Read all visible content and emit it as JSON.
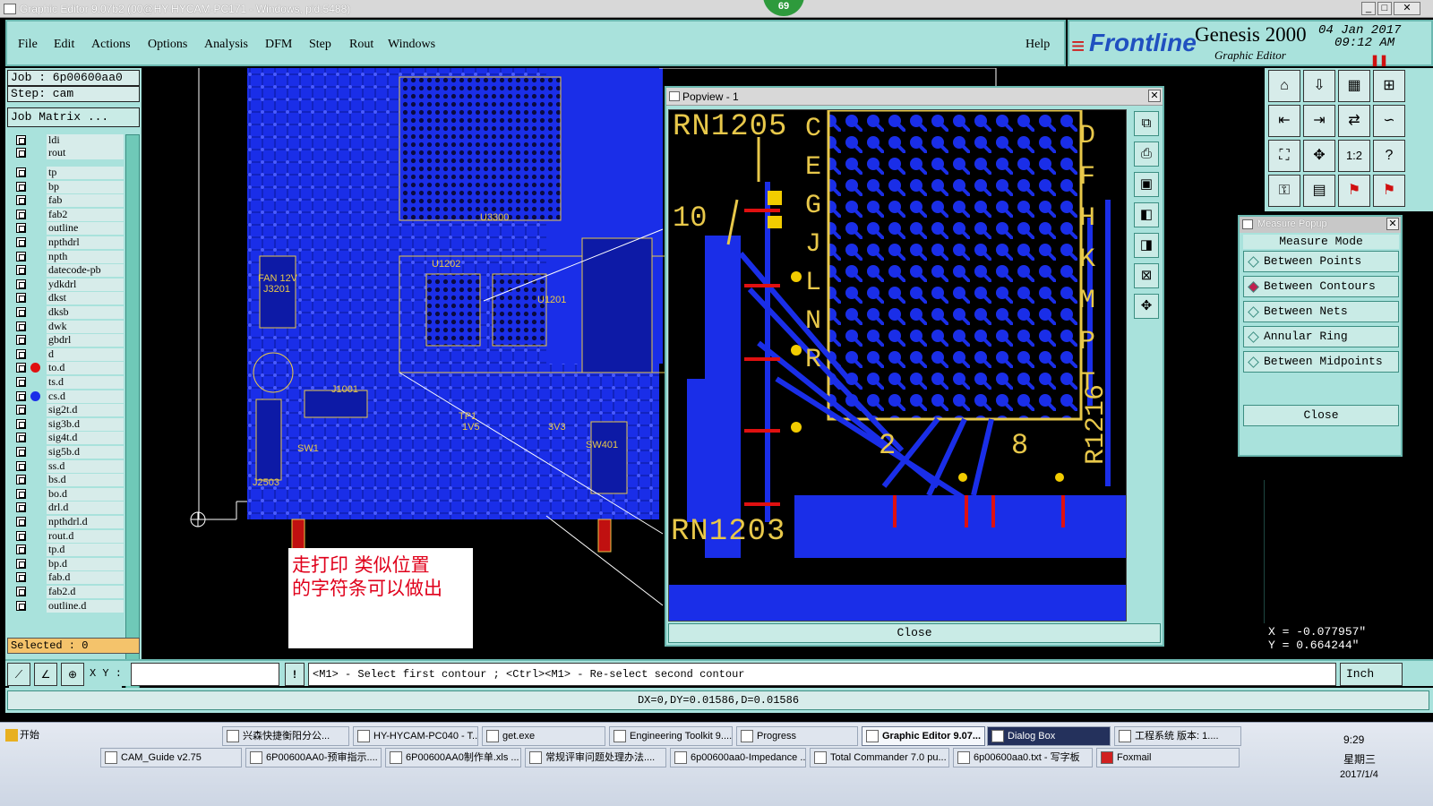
{
  "window": {
    "title": "Graphic Editor 9.07b2 (00@HY-HYCAM-PC171 - Windows, pid:5488)",
    "badge_count": "69",
    "min": "_",
    "max": "□",
    "close": "✕"
  },
  "menu": [
    "File",
    "Edit",
    "Actions",
    "Options",
    "Analysis",
    "DFM",
    "Step",
    "Rout",
    "Windows"
  ],
  "help": "Help",
  "brand": {
    "logo": "Frontline",
    "product": "Genesis 2000",
    "subtitle": "Graphic Editor",
    "date": "04 Jan 2017",
    "time": "09:12 AM"
  },
  "left": {
    "job": "Job : 6p00600aa0",
    "step": "Step: cam",
    "matrix_btn": "Job Matrix ...",
    "selected": "Selected : 0",
    "layers": [
      "ldi",
      "rout",
      "tp",
      "bp",
      "fab",
      "fab2",
      "outline",
      "npthdrl",
      "npth",
      "datecode-pb",
      "ydkdrl",
      "dkst",
      "dksb",
      "dwk",
      "gbdrl",
      "d",
      "to.d",
      "ts.d",
      "cs.d",
      "sig2t.d",
      "sig3b.d",
      "sig4t.d",
      "sig5b.d",
      "ss.d",
      "bs.d",
      "bo.d",
      "drl.d",
      "npthdrl.d",
      "rout.d",
      "tp.d",
      "bp.d",
      "fab.d",
      "fab2.d",
      "outline.d"
    ]
  },
  "popview": {
    "title": "Popview - 1",
    "close": "Close",
    "labels": [
      "RN1205",
      "RN1203",
      "R1216",
      "10",
      "2",
      "8"
    ],
    "letters_left": [
      "C",
      "E",
      "G",
      "J",
      "L",
      "N",
      "R"
    ],
    "letters_right": [
      "D",
      "F",
      "H",
      "K",
      "M",
      "P",
      "T"
    ]
  },
  "board_labels": [
    "U3300",
    "U1202",
    "U1201",
    "J1001",
    "J2503",
    "FAN 12V",
    "J3201",
    "SW401",
    "SW1",
    "1V5",
    "3V3",
    "TP1"
  ],
  "measure": {
    "title": "Measure Popup",
    "mode": "Measure Mode",
    "options": [
      "Between Points",
      "Between Contours",
      "Between Nets",
      "Annular Ring",
      "Between Midpoints"
    ],
    "selected": "Between Contours",
    "close": "Close"
  },
  "coords": {
    "x": "X = -0.077957\"",
    "y": "Y = 0.664244\""
  },
  "cmd": {
    "xy_label": "X Y :",
    "xy_value": "",
    "prompt": "<M1> - Select first contour ; <Ctrl><M1> - Re-select second contour",
    "units": "Inch",
    "status": "DX=0,DY=0.01586,D=0.01586"
  },
  "note": {
    "line1": "走打印  类似位置",
    "line2": "的字符条可以做出"
  },
  "taskbar": {
    "start": "开始",
    "row1": [
      "兴森快捷衡阳分公...",
      "HY-HYCAM-PC040 - T...",
      "get.exe",
      "Engineering Toolkit 9....",
      "Progress",
      "Graphic Editor 9.07...",
      "Dialog Box",
      "工程系统  版本: 1...."
    ],
    "row2": [
      "CAM_Guide v2.75",
      "6P00600AA0-预审指示....",
      "6P00600AA0制作单.xls ...",
      "常规评审问题处理办法....",
      "6p00600aa0-Impedance ...",
      "Total Commander 7.0 pu...",
      "6p00600aa0.txt - 写字板",
      "Foxmail"
    ],
    "clock_time": "9:29",
    "clock_day": "星期三",
    "clock_date": "2017/1/4"
  },
  "colors": {
    "panel": "#a9e2dc",
    "board_blue": "#1a2ee8",
    "silk": "#e8c84a",
    "mask_red": "#e01010"
  }
}
